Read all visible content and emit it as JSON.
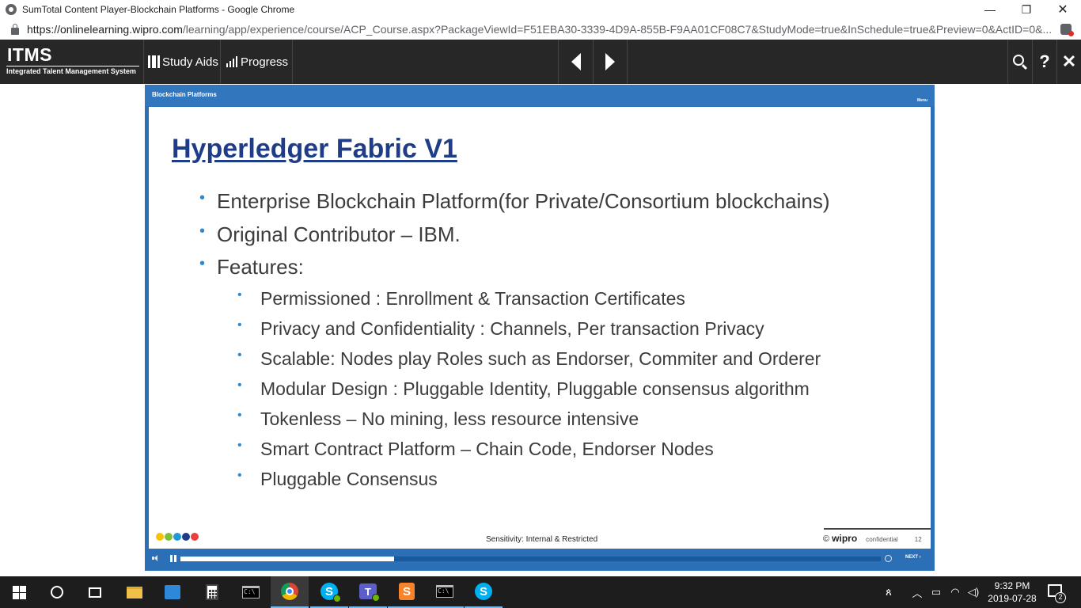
{
  "browser": {
    "window_title": "SumTotal Content Player-Blockchain Platforms - Google Chrome",
    "url_host": "https://onlinelearning.wipro.com",
    "url_path": "/learning/app/experience/course/ACP_Course.aspx?PackageViewId=F51EBA30-3339-4D9A-855B-F9AA01CF08C7&StudyMode=true&InSchedule=true&Preview=0&ActID=0&...",
    "controls": {
      "minimize": "—",
      "maximize": "❐",
      "close": "✕"
    }
  },
  "app": {
    "logo": "ITMS",
    "logo_sub": "Integrated Talent Management System",
    "nav": {
      "study_aids": "Study Aids",
      "progress": "Progress"
    },
    "tools": {
      "help": "?",
      "close": "✕"
    }
  },
  "player": {
    "header_title": "Blockchain Platforms",
    "menu": "Menu",
    "progress": 0.305,
    "next": "NEXT ›"
  },
  "slide": {
    "title": "Hyperledger Fabric V1",
    "bullets": [
      "Enterprise Blockchain Platform(for Private/Consortium blockchains)",
      "Original Contributor – IBM.",
      "Features:"
    ],
    "sub_bullets": [
      "Permissioned : Enrollment & Transaction Certificates",
      "Privacy and Confidentiality : Channels, Per transaction Privacy",
      "Scalable: Nodes play Roles such as Endorser, Commiter and Orderer",
      "Modular Design : Pluggable Identity, Pluggable consensus algorithm",
      "Tokenless – No mining, less resource intensive",
      "Smart Contract Platform – Chain Code, Endorser Nodes",
      "Pluggable Consensus"
    ],
    "bullet_glyph": "•",
    "sensitivity": "Sensitivity: Internal & Restricted",
    "footer_brand": "wipro",
    "footer_copyright": "©",
    "footer_confidential": "confidential",
    "page_number": "12",
    "dot_colors": [
      "#f5c400",
      "#7cbf3b",
      "#1f9ad6",
      "#1f3c88",
      "#e8413c"
    ]
  },
  "taskbar": {
    "time": "9:32 PM",
    "date": "2019-07-28",
    "notification_count": "2",
    "apps": [
      "start-icon",
      "cortana-icon",
      "task-view-icon",
      "file-explorer-icon",
      "remote-desktop-icon",
      "calculator-icon",
      "cmd-icon",
      "chrome-icon",
      "skype-business-icon",
      "teams-icon",
      "sublime-text-icon",
      "cmd-icon",
      "skype-icon"
    ]
  }
}
